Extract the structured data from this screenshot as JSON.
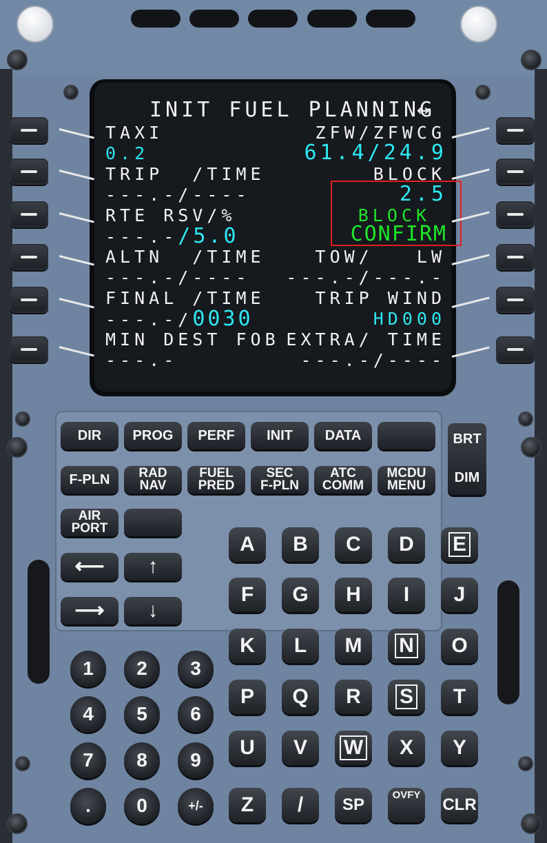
{
  "screen": {
    "title": "INIT FUEL PLANNING",
    "title_arrow": "↔",
    "left": [
      {
        "label": "TAXI",
        "value": "0.2"
      },
      {
        "label": "TRIP  /TIME",
        "value": "---.-/----"
      },
      {
        "label": "RTE RSV/%",
        "value_white": "---.-",
        "value_cyan": "/5.0"
      },
      {
        "label": "ALTN  /TIME",
        "value": "---.-/----"
      },
      {
        "label": "FINAL /TIME",
        "value_white": "---.-/",
        "value_cyan": "0030"
      },
      {
        "label": "MIN DEST FOB",
        "value": "---.-"
      }
    ],
    "right": [
      {
        "label": "ZFW/ZFWCG",
        "value": "61.4/24.9"
      },
      {
        "label": "BLOCK",
        "value": "2.5"
      },
      {
        "label": "BLOCK",
        "value": "CONFIRM"
      },
      {
        "label": "TOW/   LW",
        "value": "---.-/---.-"
      },
      {
        "label": "TRIP WIND",
        "value": "HD000"
      },
      {
        "label": "EXTRA/ TIME",
        "value": "---.-/----"
      }
    ]
  },
  "function_keys": {
    "row1": [
      "DIR",
      "PROG",
      "PERF",
      "INIT",
      "DATA",
      ""
    ],
    "row2": [
      {
        "line1": "F-PLN",
        "line2": ""
      },
      {
        "line1": "RAD",
        "line2": "NAV"
      },
      {
        "line1": "FUEL",
        "line2": "PRED"
      },
      {
        "line1": "SEC",
        "line2": "F-PLN"
      },
      {
        "line1": "ATC",
        "line2": "COMM"
      },
      {
        "line1": "MCDU",
        "line2": "MENU"
      }
    ],
    "airport": {
      "line1": "AIR",
      "line2": "PORT"
    },
    "brt": "BRT",
    "dim": "DIM"
  },
  "letter_keys": [
    [
      "A",
      "B",
      "C",
      "D",
      "E"
    ],
    [
      "F",
      "G",
      "H",
      "I",
      "J"
    ],
    [
      "K",
      "L",
      "M",
      "N",
      "O"
    ],
    [
      "P",
      "Q",
      "R",
      "S",
      "T"
    ],
    [
      "U",
      "V",
      "W",
      "X",
      "Y"
    ],
    [
      "Z",
      "/",
      "SP",
      "OVFY",
      "CLR"
    ]
  ],
  "number_keys": [
    [
      "1",
      "2",
      "3"
    ],
    [
      "4",
      "5",
      "6"
    ],
    [
      "7",
      "8",
      "9"
    ],
    [
      ".",
      "0",
      "+/-"
    ]
  ],
  "colors": {
    "cyan": "#2ee8f4",
    "green": "#1ee62a",
    "white": "#f2f2f2",
    "highlight": "#e12020",
    "panel": "#6f84a0"
  }
}
